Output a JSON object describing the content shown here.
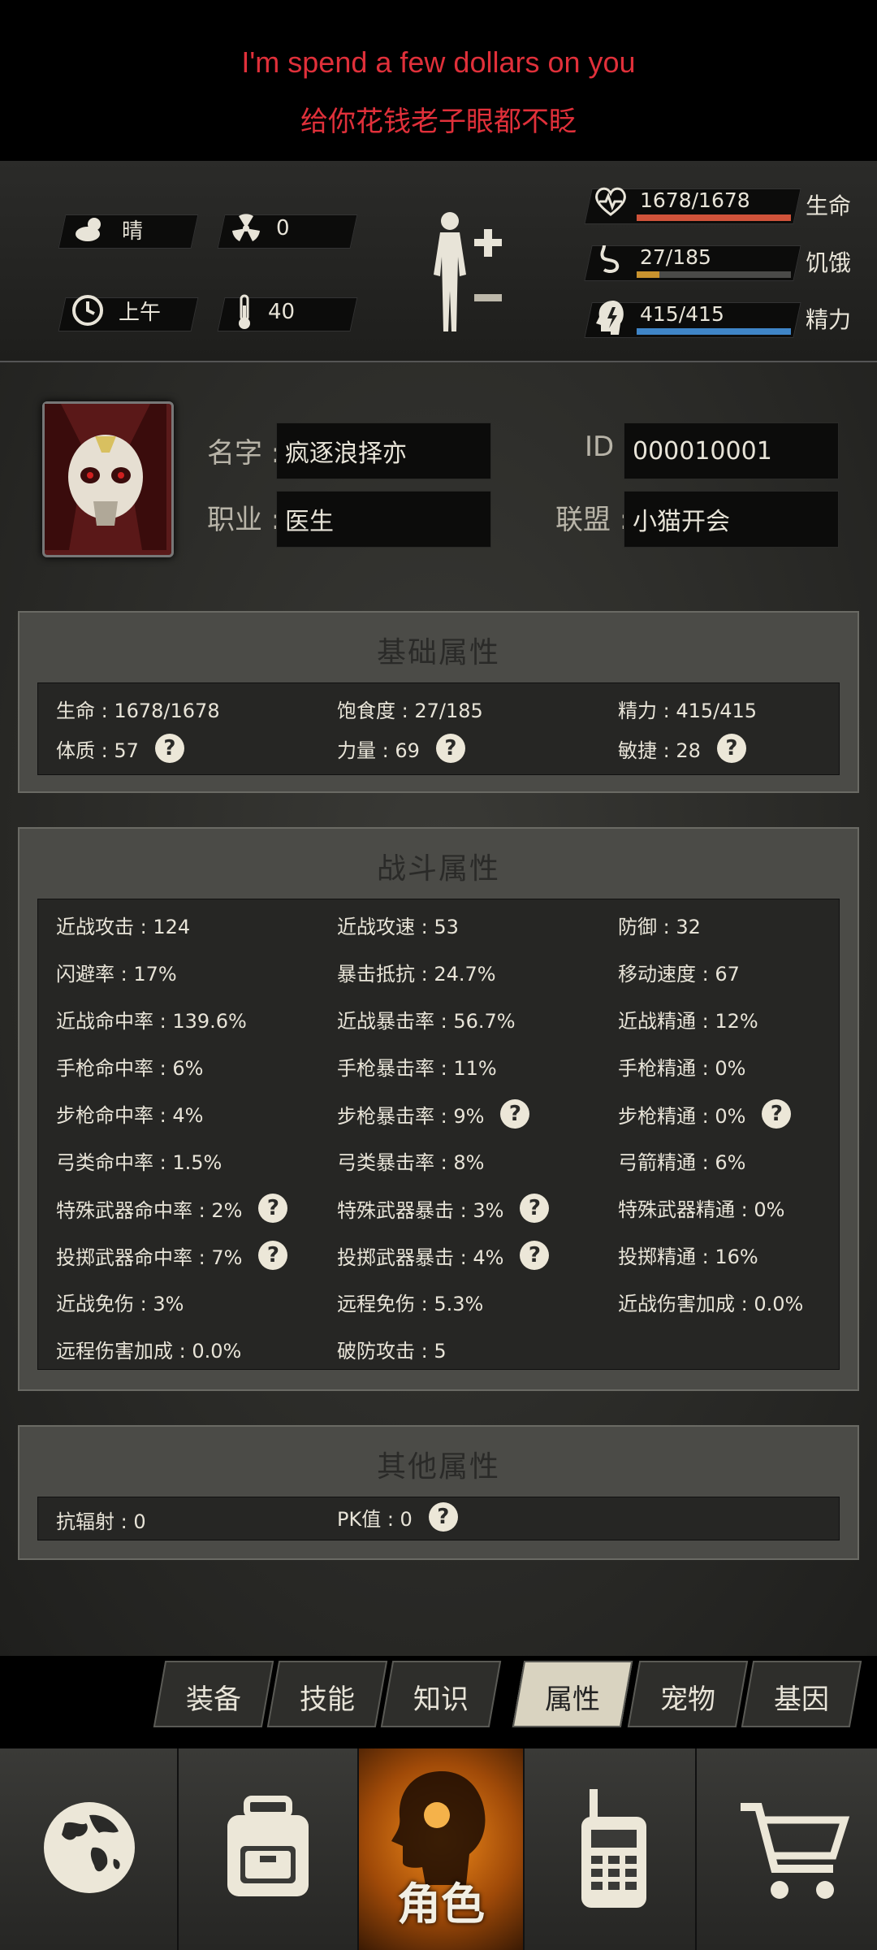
{
  "ad": {
    "line1": "I'm spend a few dollars on you",
    "line2": "给你花钱老子眼都不眨"
  },
  "status": {
    "weather": "晴",
    "radiation": "0",
    "time_of_day": "上午",
    "temperature": "40",
    "health": {
      "value": "1678/1678",
      "label": "生命",
      "fill": 1.0,
      "color": "#d0533a"
    },
    "hunger": {
      "value": "27/185",
      "label": "饥饿",
      "fill": 0.146,
      "color": "#c9932e"
    },
    "energy": {
      "value": "415/415",
      "label": "精力",
      "fill": 1.0,
      "color": "#3f85c7"
    }
  },
  "profile": {
    "name_label": "名字",
    "name": "疯逐浪择亦",
    "id_label": "ID",
    "id": "000010001",
    "job_label": "职业",
    "job": "医生",
    "alliance_label": "联盟",
    "alliance": "小猫开会"
  },
  "basic": {
    "title": "基础属性",
    "health": "生命 : 1678/1678",
    "satiety": "饱食度 : 27/185",
    "energy": "精力 : 415/415",
    "constitution": "体质 : 57",
    "strength": "力量 : 69",
    "agility": "敏捷 : 28"
  },
  "combat": {
    "title": "战斗属性",
    "rows": [
      [
        "近战攻击 : 124",
        "近战攻速 : 53",
        "防御 : 32"
      ],
      [
        "闪避率 : 17%",
        "暴击抵抗 : 24.7%",
        "移动速度 : 67"
      ],
      [
        "近战命中率 : 139.6%",
        "近战暴击率 : 56.7%",
        "近战精通 : 12%"
      ],
      [
        "手枪命中率 : 6%",
        "手枪暴击率 : 11%",
        "手枪精通 : 0%"
      ],
      [
        "步枪命中率 : 4%",
        "步枪暴击率 : 9%",
        "步枪精通 : 0%"
      ],
      [
        "弓类命中率 : 1.5%",
        "弓类暴击率 : 8%",
        "弓箭精通 : 6%"
      ],
      [
        "特殊武器命中率 : 2%",
        "特殊武器暴击 : 3%",
        "特殊武器精通 : 0%"
      ],
      [
        "投掷武器命中率 : 7%",
        "投掷武器暴击 : 4%",
        "投掷精通 : 16%"
      ],
      [
        "近战免伤 : 3%",
        "远程免伤 : 5.3%",
        "近战伤害加成 : 0.0%"
      ],
      [
        "远程伤害加成 : 0.0%",
        "破防攻击 : 5",
        ""
      ]
    ]
  },
  "other": {
    "title": "其他属性",
    "radiation_resist": "抗辐射 : 0",
    "pk": "PK值 : 0"
  },
  "tabs": [
    "装备",
    "技能",
    "知识",
    "属性",
    "宠物",
    "基因"
  ],
  "nav": {
    "character_label": "角色"
  },
  "help_glyph": "?"
}
